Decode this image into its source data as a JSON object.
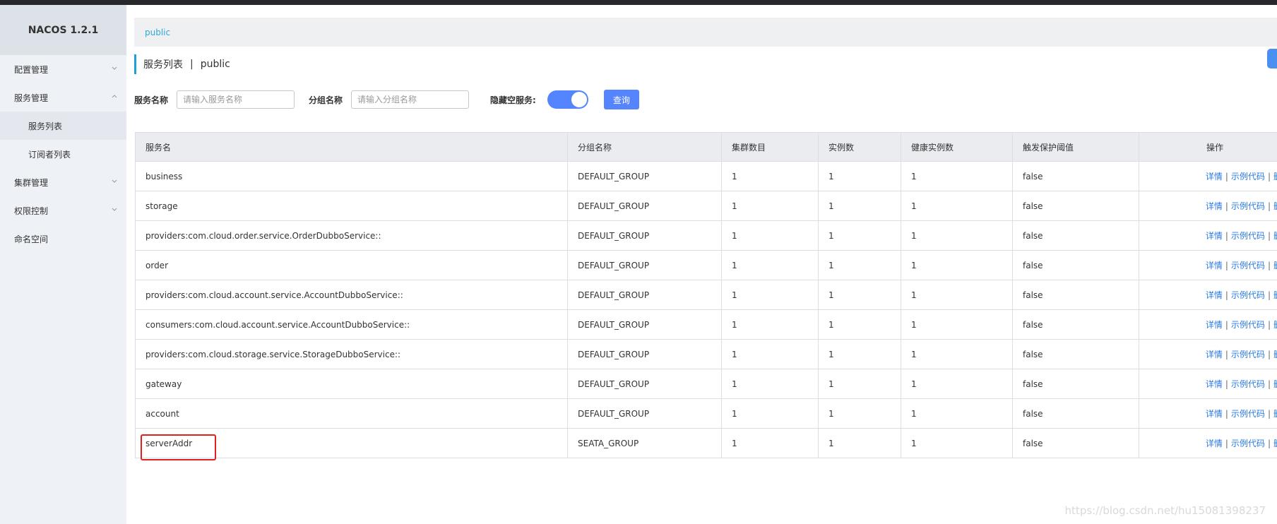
{
  "app": {
    "brand": "NACOS 1.2.1"
  },
  "sidebar": {
    "items": [
      {
        "label": "配置管理"
      },
      {
        "label": "服务管理"
      },
      {
        "label": "服务列表"
      },
      {
        "label": "订阅者列表"
      },
      {
        "label": "集群管理"
      },
      {
        "label": "权限控制"
      },
      {
        "label": "命名空间"
      }
    ]
  },
  "breadcrumb": {
    "namespace": "public"
  },
  "page": {
    "title": "服务列表",
    "separator": "|",
    "namespace": "public"
  },
  "filters": {
    "service_label": "服务名称",
    "service_placeholder": "请输入服务名称",
    "group_label": "分组名称",
    "group_placeholder": "请输入分组名称",
    "hide_empty_label": "隐藏空服务:",
    "query_label": "查询"
  },
  "table": {
    "headers": [
      "服务名",
      "分组名称",
      "集群数目",
      "实例数",
      "健康实例数",
      "触发保护阈值",
      "操作"
    ],
    "actions": {
      "detail": "详情",
      "sample": "示例代码",
      "delete": "删除"
    },
    "rows": [
      {
        "name": "business",
        "group": "DEFAULT_GROUP",
        "clusters": "1",
        "instances": "1",
        "healthy": "1",
        "threshold": "false"
      },
      {
        "name": "storage",
        "group": "DEFAULT_GROUP",
        "clusters": "1",
        "instances": "1",
        "healthy": "1",
        "threshold": "false"
      },
      {
        "name": "providers:com.cloud.order.service.OrderDubboService::",
        "group": "DEFAULT_GROUP",
        "clusters": "1",
        "instances": "1",
        "healthy": "1",
        "threshold": "false"
      },
      {
        "name": "order",
        "group": "DEFAULT_GROUP",
        "clusters": "1",
        "instances": "1",
        "healthy": "1",
        "threshold": "false"
      },
      {
        "name": "providers:com.cloud.account.service.AccountDubboService::",
        "group": "DEFAULT_GROUP",
        "clusters": "1",
        "instances": "1",
        "healthy": "1",
        "threshold": "false"
      },
      {
        "name": "consumers:com.cloud.account.service.AccountDubboService::",
        "group": "DEFAULT_GROUP",
        "clusters": "1",
        "instances": "1",
        "healthy": "1",
        "threshold": "false"
      },
      {
        "name": "providers:com.cloud.storage.service.StorageDubboService::",
        "group": "DEFAULT_GROUP",
        "clusters": "1",
        "instances": "1",
        "healthy": "1",
        "threshold": "false"
      },
      {
        "name": "gateway",
        "group": "DEFAULT_GROUP",
        "clusters": "1",
        "instances": "1",
        "healthy": "1",
        "threshold": "false"
      },
      {
        "name": "account",
        "group": "DEFAULT_GROUP",
        "clusters": "1",
        "instances": "1",
        "healthy": "1",
        "threshold": "false"
      },
      {
        "name": "serverAddr",
        "group": "SEATA_GROUP",
        "clusters": "1",
        "instances": "1",
        "healthy": "1",
        "threshold": "false"
      }
    ]
  },
  "watermark": "https://blog.csdn.net/hu15081398237",
  "colors": {
    "accent": "#5584ff",
    "link": "#2a7ae0",
    "highlight": "#e02020"
  }
}
